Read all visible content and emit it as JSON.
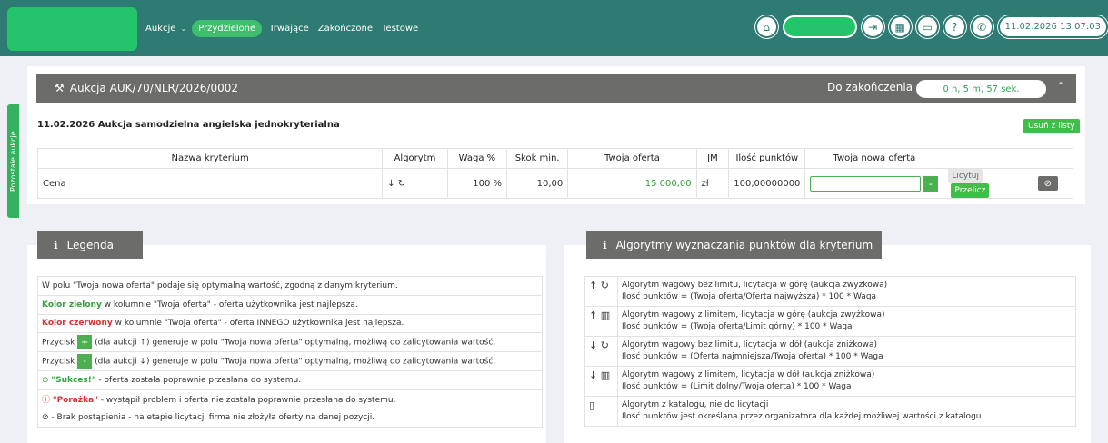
{
  "nav": {
    "menu": [
      {
        "label": "Aukcje",
        "has_dropdown": true,
        "active": false
      },
      {
        "label": "Przydzielone",
        "active": true
      },
      {
        "label": "Trwające",
        "active": false
      },
      {
        "label": "Zakończone",
        "active": false
      },
      {
        "label": "Testowe",
        "active": false
      }
    ],
    "datetime": "11.02.2026 13:07:03",
    "colors": {
      "bar": "#2e7b73",
      "accent": "#23c46a"
    }
  },
  "side_tab": {
    "label": "Pozostałe aukcje"
  },
  "auction": {
    "title": "Aukcja AUK/70/NLR/2026/0002",
    "end_label": "Do zakończenia",
    "countdown": "0 h, 5 m, 57 sek.",
    "subtitle": "11.02.2026 Aukcja samodzielna angielska jednokryterialna",
    "remove_button": "Usuń z listy",
    "table": {
      "headers": [
        "Nazwa kryterium",
        "Algorytm",
        "Waga %",
        "Skok min.",
        "Twoja oferta",
        "JM",
        "Ilość punktów",
        "Twoja nowa oferta"
      ],
      "row": {
        "name": "Cena",
        "algorithm": "↓ ↻",
        "weight": "100 %",
        "min_step": "10,00",
        "your_offer": "15 000,00",
        "unit": "zł",
        "points": "100,00000000",
        "new_offer_value": "",
        "minus": "-",
        "bid_button": "Licytuj",
        "recalc_button": "Przelicz",
        "ban_icon": "⃠"
      }
    }
  },
  "legend": {
    "title": "Legenda",
    "rows": [
      {
        "pre": "",
        "key": "",
        "text": "W polu \"Twoja nowa oferta\" podaje się optymalną wartość, zgodną z danym kryterium."
      },
      {
        "pre": "",
        "key": "Kolor zielony",
        "text": " w kolumnie \"Twoja oferta\" - oferta użytkownika jest najlepsza."
      },
      {
        "pre": "",
        "key": "Kolor czerwony",
        "text": " w kolumnie \"Twoja oferta\" - oferta INNEGO użytkownika jest najlepsza."
      },
      {
        "pre": "Przycisk ",
        "key": "+",
        "text": " (dla aukcji ↑) generuje w polu \"Twoja nowa oferta\" optymalną, możliwą do zalicytowania wartość."
      },
      {
        "pre": "Przycisk ",
        "key": "-",
        "text": " (dla aukcji ↓) generuje w polu \"Twoja nowa oferta\" optymalną, możliwą do zalicytowania wartość."
      },
      {
        "pre": "",
        "key": "\"Sukces!\"",
        "text": " - oferta została poprawnie przesłana do systemu."
      },
      {
        "pre": "",
        "key": "\"Porażka\"",
        "text": " - wystąpił problem i oferta nie została poprawnie przesłana do systemu."
      },
      {
        "pre": "",
        "key": "",
        "text": " - Brak postąpienia - na etapie licytacji firma nie złożyła oferty na danej pozycji."
      }
    ]
  },
  "algorithms": {
    "title": "Algorytmy wyznaczania punktów dla kryterium",
    "rows": [
      {
        "icon": "↑ ↻",
        "line1": "Algorytm wagowy bez limitu, licytacja w górę (aukcja zwyżkowa)",
        "line2": "Ilość punktów = (Twoja oferta/Oferta najwyższa) * 100 * Waga"
      },
      {
        "icon": "↑ ▥",
        "line1": "Algorytm wagowy z limitem, licytacja w górę (aukcja zwyżkowa)",
        "line2": "Ilość punktów = (Twoja oferta/Limit górny) * 100 * Waga"
      },
      {
        "icon": "↓ ↻",
        "line1": "Algorytm wagowy bez limitu, licytacja w dół (aukcja zniżkowa)",
        "line2": "Ilość punktów = (Oferta najmniejsza/Twoja oferta) * 100 * Waga"
      },
      {
        "icon": "↓ ▥",
        "line1": "Algorytm wagowy z limitem, licytacja w dół (aukcja zniżkowa)",
        "line2": "Ilość punktów = (Limit dolny/Twoja oferta) * 100 * Waga"
      },
      {
        "icon": "▯",
        "line1": "Algorytm z katalogu, nie do licytacji",
        "line2": "Ilość punktów jest określana przez organizatora dla każdej możliwej wartości z katalogu"
      }
    ]
  }
}
